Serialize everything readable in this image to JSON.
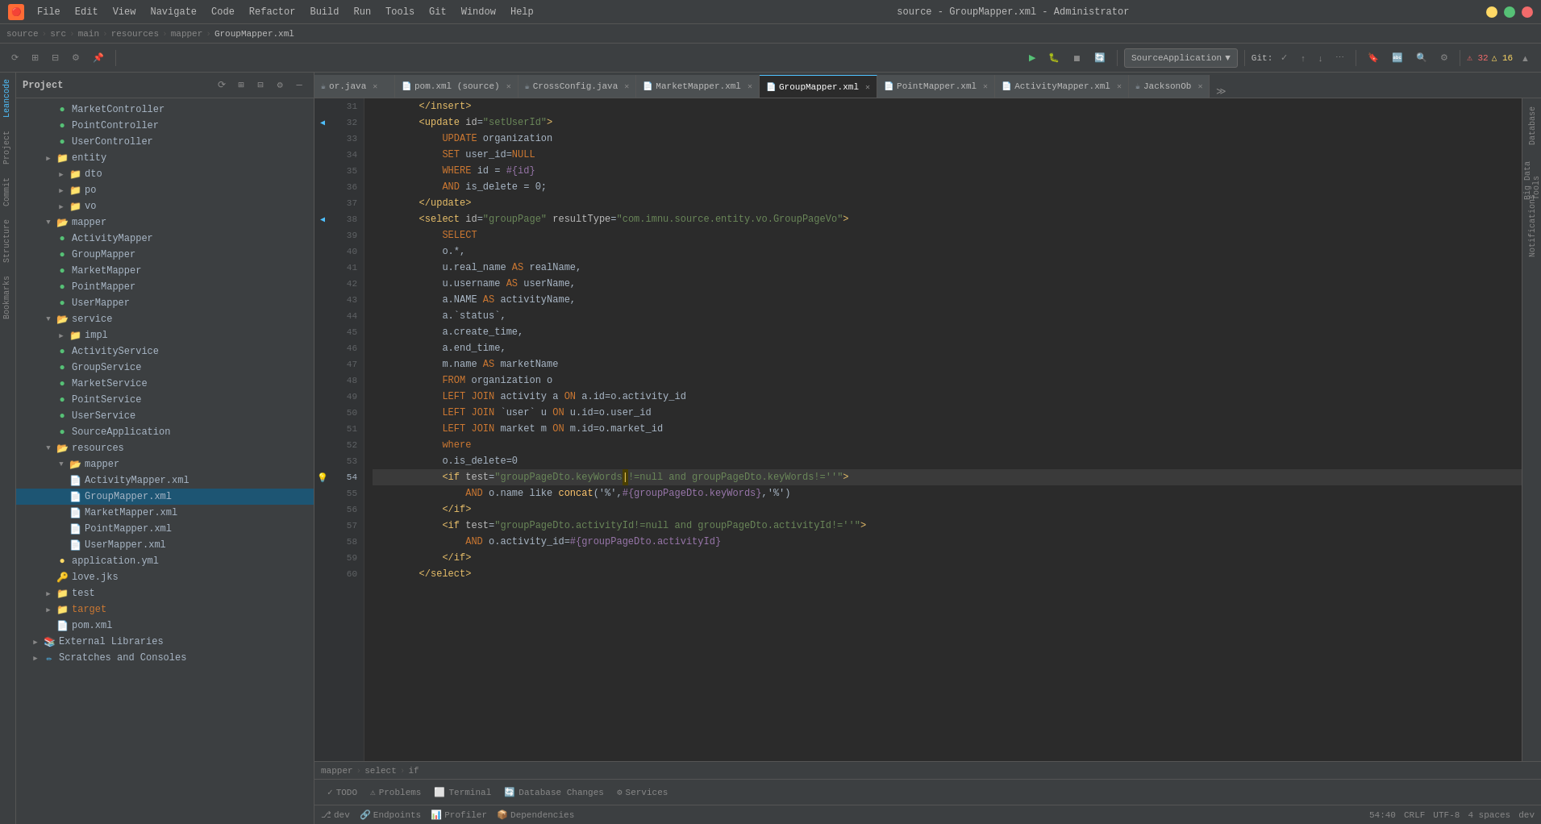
{
  "titleBar": {
    "title": "source - GroupMapper.xml - Administrator",
    "menu": [
      "File",
      "Edit",
      "View",
      "Navigate",
      "Code",
      "Refactor",
      "Build",
      "Run",
      "Tools",
      "Git",
      "Window",
      "Help"
    ]
  },
  "breadcrumb": {
    "items": [
      "source",
      "src",
      "main",
      "resources",
      "mapper",
      "GroupMapper.xml"
    ]
  },
  "tabs": [
    {
      "id": "or-java",
      "name": "or.java",
      "icon": "☕",
      "modified": false
    },
    {
      "id": "pom-xml",
      "name": "pom.xml (source)",
      "icon": "📄",
      "modified": false
    },
    {
      "id": "cross-config",
      "name": "CrossConfig.java",
      "icon": "☕",
      "modified": false
    },
    {
      "id": "market-mapper",
      "name": "MarketMapper.xml",
      "icon": "📄",
      "modified": false
    },
    {
      "id": "group-mapper",
      "name": "GroupMapper.xml",
      "icon": "📄",
      "modified": false,
      "active": true
    },
    {
      "id": "point-mapper",
      "name": "PointMapper.xml",
      "icon": "📄",
      "modified": false
    },
    {
      "id": "activity-mapper",
      "name": "ActivityMapper.xml",
      "icon": "📄",
      "modified": false
    },
    {
      "id": "jackson",
      "name": "JacksonOb",
      "icon": "☕",
      "modified": false
    }
  ],
  "toolbar": {
    "sourceApp": "SourceApplication",
    "gitLabel": "Git:",
    "errorCount": "32",
    "warnCount": "16"
  },
  "projectTree": {
    "title": "Project",
    "items": [
      {
        "indent": 3,
        "type": "class",
        "label": "MarketController",
        "icon": "🟢"
      },
      {
        "indent": 3,
        "type": "class",
        "label": "PointController",
        "icon": "🟢"
      },
      {
        "indent": 3,
        "type": "class",
        "label": "UserController",
        "icon": "🟢"
      },
      {
        "indent": 2,
        "type": "folder",
        "label": "entity",
        "arrow": "▶"
      },
      {
        "indent": 3,
        "type": "folder",
        "label": "dto",
        "arrow": "▶"
      },
      {
        "indent": 3,
        "type": "folder",
        "label": "po",
        "arrow": "▶"
      },
      {
        "indent": 3,
        "type": "folder",
        "label": "vo",
        "arrow": "▶"
      },
      {
        "indent": 2,
        "type": "folder",
        "label": "mapper",
        "arrow": "▼"
      },
      {
        "indent": 3,
        "type": "class",
        "label": "ActivityMapper",
        "icon": "🟢"
      },
      {
        "indent": 3,
        "type": "class",
        "label": "GroupMapper",
        "icon": "🟢"
      },
      {
        "indent": 3,
        "type": "class",
        "label": "MarketMapper",
        "icon": "🟢"
      },
      {
        "indent": 3,
        "type": "class",
        "label": "PointMapper",
        "icon": "🟢"
      },
      {
        "indent": 3,
        "type": "class",
        "label": "UserMapper",
        "icon": "🟢"
      },
      {
        "indent": 2,
        "type": "folder",
        "label": "service",
        "arrow": "▼"
      },
      {
        "indent": 3,
        "type": "folder",
        "label": "impl",
        "arrow": "▶"
      },
      {
        "indent": 3,
        "type": "class",
        "label": "ActivityService",
        "icon": "🟢"
      },
      {
        "indent": 3,
        "type": "class",
        "label": "GroupService",
        "icon": "🟢"
      },
      {
        "indent": 3,
        "type": "class",
        "label": "MarketService",
        "icon": "🟢"
      },
      {
        "indent": 3,
        "type": "class",
        "label": "PointService",
        "icon": "🟢"
      },
      {
        "indent": 3,
        "type": "class",
        "label": "UserService",
        "icon": "🟢"
      },
      {
        "indent": 3,
        "type": "class",
        "label": "SourceApplication",
        "icon": "🟢"
      },
      {
        "indent": 2,
        "type": "folder",
        "label": "resources",
        "arrow": "▼"
      },
      {
        "indent": 3,
        "type": "folder",
        "label": "mapper",
        "arrow": "▼"
      },
      {
        "indent": 4,
        "type": "xml",
        "label": "ActivityMapper.xml",
        "icon": "📄"
      },
      {
        "indent": 4,
        "type": "xml",
        "label": "GroupMapper.xml",
        "icon": "📄",
        "selected": true
      },
      {
        "indent": 4,
        "type": "xml",
        "label": "MarketMapper.xml",
        "icon": "📄"
      },
      {
        "indent": 4,
        "type": "xml",
        "label": "PointMapper.xml",
        "icon": "📄"
      },
      {
        "indent": 4,
        "type": "xml",
        "label": "UserMapper.xml",
        "icon": "📄"
      },
      {
        "indent": 3,
        "type": "yaml",
        "label": "application.yml",
        "icon": "🟡"
      },
      {
        "indent": 3,
        "type": "file",
        "label": "love.jks",
        "icon": "🔑"
      },
      {
        "indent": 2,
        "type": "folder",
        "label": "test",
        "arrow": "▶"
      },
      {
        "indent": 2,
        "type": "folder",
        "label": "target",
        "arrow": "▶",
        "special": "orange"
      },
      {
        "indent": 3,
        "type": "xml",
        "label": "pom.xml",
        "icon": "📄"
      },
      {
        "indent": 1,
        "type": "folder",
        "label": "External Libraries",
        "arrow": "▶"
      },
      {
        "indent": 1,
        "type": "folder",
        "label": "Scratches and Consoles",
        "arrow": "▶"
      }
    ]
  },
  "codeLines": [
    {
      "num": 31,
      "content": "        </insert>"
    },
    {
      "num": 32,
      "content": "        <update id=\"setUserId\">"
    },
    {
      "num": 33,
      "content": "            UPDATE organization"
    },
    {
      "num": 34,
      "content": "            SET user_id=NULL"
    },
    {
      "num": 35,
      "content": "            WHERE id = #{id}"
    },
    {
      "num": 36,
      "content": "            AND is_delete = 0;"
    },
    {
      "num": 37,
      "content": "        </update>"
    },
    {
      "num": 38,
      "content": "        <select id=\"groupPage\" resultType=\"com.imnu.source.entity.vo.GroupPageVo\">"
    },
    {
      "num": 39,
      "content": "            SELECT"
    },
    {
      "num": 40,
      "content": "            o.*,"
    },
    {
      "num": 41,
      "content": "            u.real_name AS realName,"
    },
    {
      "num": 42,
      "content": "            u.username AS userName,"
    },
    {
      "num": 43,
      "content": "            a.NAME AS activityName,"
    },
    {
      "num": 44,
      "content": "            a.`status`,"
    },
    {
      "num": 45,
      "content": "            a.create_time,"
    },
    {
      "num": 46,
      "content": "            a.end_time,"
    },
    {
      "num": 47,
      "content": "            m.name AS marketName"
    },
    {
      "num": 48,
      "content": "            FROM organization o"
    },
    {
      "num": 49,
      "content": "            LEFT JOIN activity a ON a.id=o.activity_id"
    },
    {
      "num": 50,
      "content": "            LEFT JOIN `user` u ON u.id=o.user_id"
    },
    {
      "num": 51,
      "content": "            LEFT JOIN market m ON m.id=o.market_id"
    },
    {
      "num": 52,
      "content": "            where"
    },
    {
      "num": 53,
      "content": "            o.is_delete=0"
    },
    {
      "num": 54,
      "content": "            <if test=\"groupPageDto.keyWords!=null and groupPageDto.keyWords!=''\">",
      "marker": "yellow"
    },
    {
      "num": 55,
      "content": "                AND o.name like concat('%',#{groupPageDto.keyWords},'%')"
    },
    {
      "num": 56,
      "content": "            </if>"
    },
    {
      "num": 57,
      "content": "            <if test=\"groupPageDto.activityId!=null and groupPageDto.activityId!=''\">"
    },
    {
      "num": 58,
      "content": "                AND o.activity_id=#{groupPageDto.activityId}"
    },
    {
      "num": 59,
      "content": "            </if>"
    },
    {
      "num": 60,
      "content": "        </select>"
    }
  ],
  "statusBar": {
    "cursor": "54:40",
    "encoding": "CRLF",
    "charset": "UTF-8",
    "indent": "4 spaces",
    "branch": "dev"
  },
  "bottomTabs": [
    {
      "label": "TODO",
      "icon": "✓"
    },
    {
      "label": "Problems",
      "icon": "⚠"
    },
    {
      "label": "Terminal",
      "icon": "⬜"
    },
    {
      "label": "Database Changes",
      "icon": "🔄"
    },
    {
      "label": "Services",
      "icon": "⚙"
    }
  ],
  "leftLabels": [
    "Leancode",
    "Project",
    "Commit",
    "Structure",
    "Bookmarks"
  ],
  "rightLabels": [
    "Database",
    "Big Data Tools",
    "Notifications"
  ],
  "secondaryBreadcrumb": {
    "items": [
      "mapper",
      "select",
      "if"
    ]
  }
}
